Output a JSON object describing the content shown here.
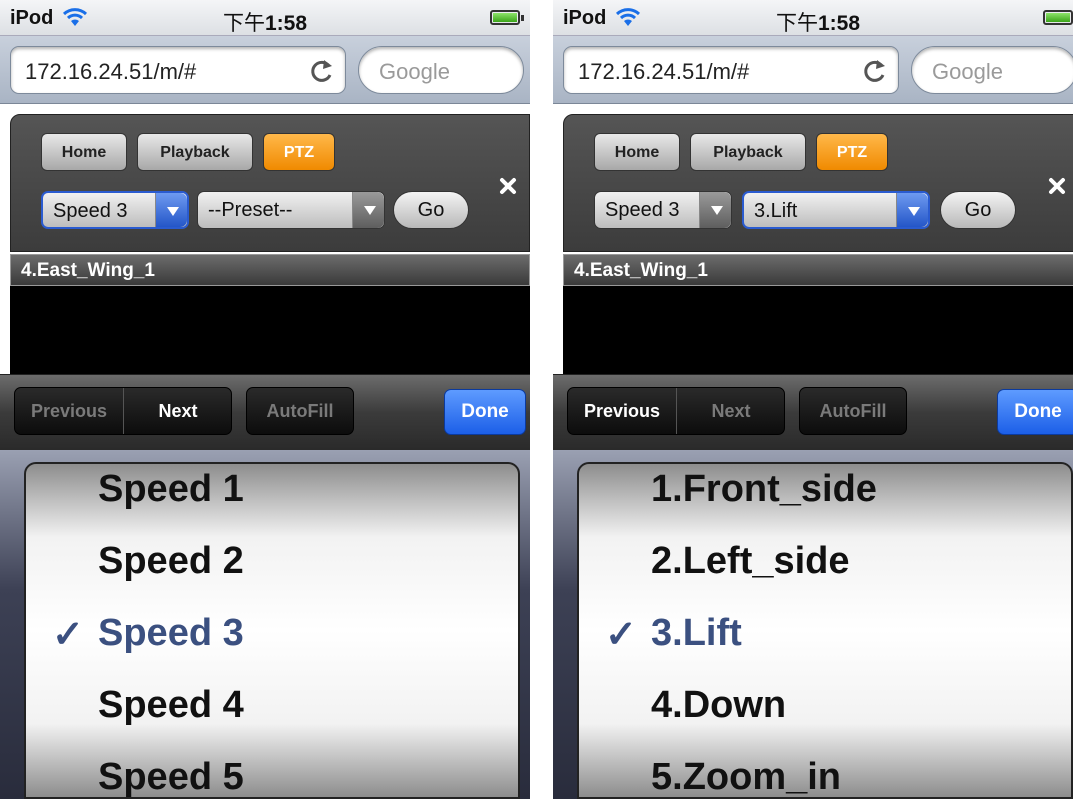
{
  "status": {
    "carrier": "iPod",
    "time_prefix": "下午",
    "time": "1:58"
  },
  "browser": {
    "url": "172.16.24.51/m/#",
    "search_placeholder": "Google"
  },
  "nav": {
    "home": "Home",
    "playback": "Playback",
    "ptz": "PTZ"
  },
  "controls": {
    "go": "Go"
  },
  "camera": {
    "title": "4.East_Wing_1"
  },
  "toolbar": {
    "previous": "Previous",
    "next": "Next",
    "autofill": "AutoFill",
    "done": "Done"
  },
  "check_mark": "✓",
  "colors": {
    "accent": "#f08a00",
    "done_blue": "#1c5fe8",
    "selected_text": "#3b5080"
  },
  "screens": [
    {
      "speed_value": "Speed 3",
      "preset_value": "--Preset--",
      "focused_control": "speed",
      "toolbar_enabled": {
        "previous": false,
        "next": true
      },
      "picker_items": [
        "Speed 1",
        "Speed 2",
        "Speed 3",
        "Speed 4",
        "Speed 5"
      ],
      "picker_selected": "Speed 3"
    },
    {
      "speed_value": "Speed 3",
      "preset_value": "3.Lift",
      "focused_control": "preset",
      "toolbar_enabled": {
        "previous": true,
        "next": false
      },
      "picker_items": [
        "1.Front_side",
        "2.Left_side",
        "3.Lift",
        "4.Down",
        "5.Zoom_in"
      ],
      "picker_selected": "3.Lift"
    }
  ]
}
